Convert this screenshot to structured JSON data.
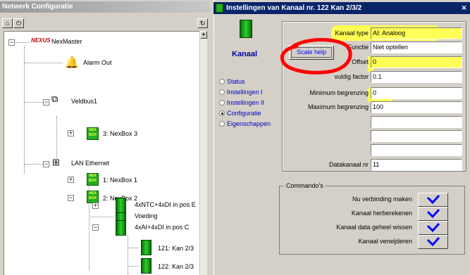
{
  "left": {
    "title": "Netwerk Configuratie",
    "tree": [
      {
        "label": "NexMaster",
        "logo": "NEXUS"
      },
      {
        "label": "Alarm Out"
      },
      {
        "label": "Veldbus1"
      },
      {
        "label": "3: NexBox 3"
      },
      {
        "label": "LAN Ethernet"
      },
      {
        "label": "1: NexBox 1"
      },
      {
        "label": "2: NexBox 2"
      },
      {
        "label": "Voeding"
      },
      {
        "label": "4xNTC+4xDI in pos E"
      },
      {
        "label": "4xAI+4xDI in pos C"
      },
      {
        "label": "121: Kan 2/3"
      },
      {
        "label": "122: Kan 2/3"
      }
    ],
    "nexbox_text": "NEX BOX"
  },
  "right": {
    "title": "Instellingen van Kanaal nr. 122   Kan 2/3/2",
    "close": "×",
    "kanaal_label": "Kanaal",
    "scale_help": "Scale help",
    "radios": [
      {
        "label": "Status",
        "checked": false
      },
      {
        "label": "Instellingen I",
        "checked": false
      },
      {
        "label": "Instellingen II",
        "checked": false
      },
      {
        "label": "Configuratie",
        "checked": true
      },
      {
        "label": "Eigenschappen",
        "checked": false
      }
    ],
    "fields": {
      "kanaal_type": {
        "label": "Kanaal type",
        "value": "AI: Analoog"
      },
      "functie": {
        "label": "Functie",
        "value": "Niet optellen"
      },
      "offset": {
        "label": "Offset",
        "value": "0"
      },
      "factor": {
        "label": "vuldig factor",
        "value": "0.1"
      },
      "min": {
        "label": "Minimum begrenzing",
        "value": "0"
      },
      "max": {
        "label": "Maximum begrenzing",
        "value": "100"
      },
      "datakanaal": {
        "label": "Datakanaal nr",
        "value": "11"
      }
    },
    "commandos": {
      "title": "Commando's",
      "items": [
        "Nu verbinding maken",
        "Kanaal herberekenen",
        "Kanaal data geheel wissen",
        "Kanaal verwijderen"
      ]
    },
    "colors": {
      "highlight": "#ffff55",
      "annotation": "#ff0000",
      "titlebar": "#0a246a"
    }
  }
}
